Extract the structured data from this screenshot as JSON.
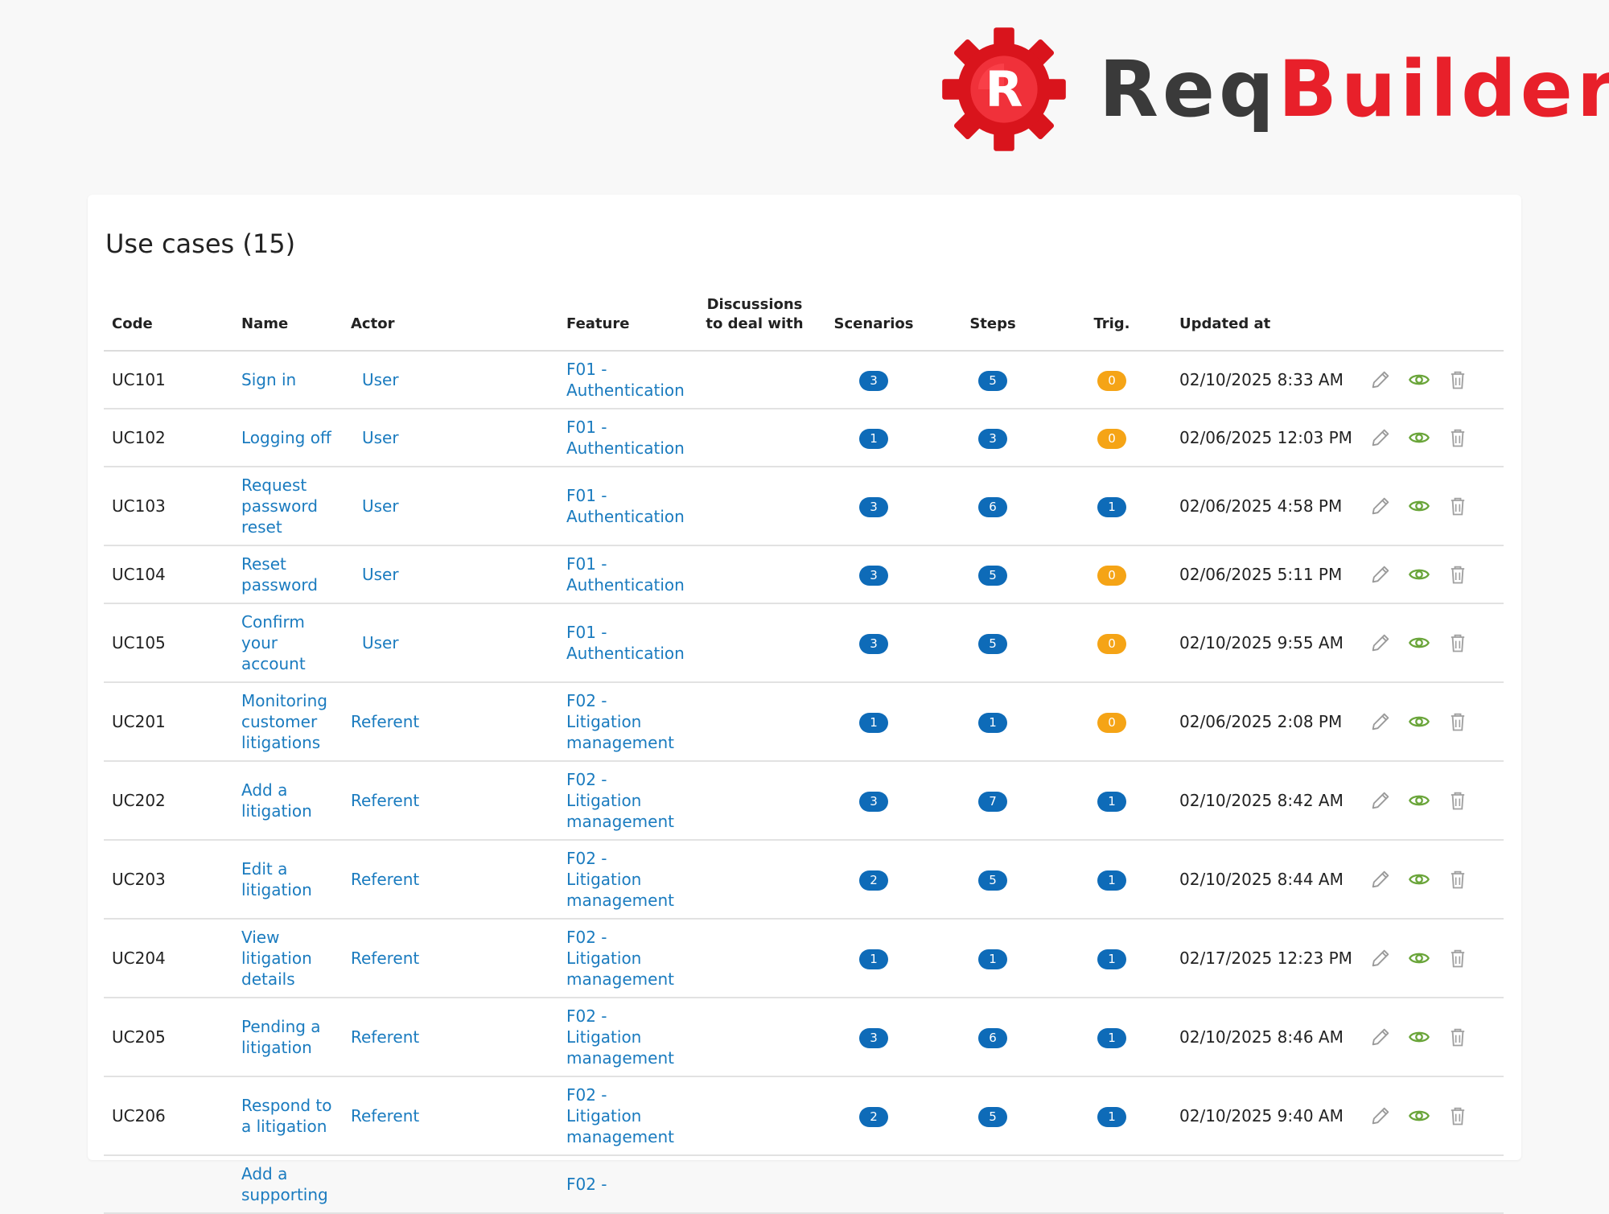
{
  "brand": {
    "req": "Req",
    "builder": "Builder",
    "logo_letter": "R"
  },
  "page": {
    "title": "Use cases (15)"
  },
  "table": {
    "headers": {
      "code": "Code",
      "name": "Name",
      "actor": "Actor",
      "feature": "Feature",
      "discussions": "Discussions to deal with",
      "scenarios": "Scenarios",
      "steps": "Steps",
      "trig": "Trig.",
      "updated": "Updated at"
    },
    "rows": [
      {
        "code": "UC101",
        "name": "Sign in",
        "actor": "User",
        "feature": "F01 - Authentication",
        "scenarios": "3",
        "steps": "5",
        "trig": "0",
        "updated": "02/10/2025 8:33 AM"
      },
      {
        "code": "UC102",
        "name": "Logging off",
        "actor": "User",
        "feature": "F01 - Authentication",
        "scenarios": "1",
        "steps": "3",
        "trig": "0",
        "updated": "02/06/2025 12:03 PM"
      },
      {
        "code": "UC103",
        "name": "Request password reset",
        "actor": "User",
        "feature": "F01 - Authentication",
        "scenarios": "3",
        "steps": "6",
        "trig": "1",
        "updated": "02/06/2025 4:58 PM"
      },
      {
        "code": "UC104",
        "name": "Reset password",
        "actor": "User",
        "feature": "F01 - Authentication",
        "scenarios": "3",
        "steps": "5",
        "trig": "0",
        "updated": "02/06/2025 5:11 PM"
      },
      {
        "code": "UC105",
        "name": "Confirm your account",
        "actor": "User",
        "feature": "F01 - Authentication",
        "scenarios": "3",
        "steps": "5",
        "trig": "0",
        "updated": "02/10/2025 9:55 AM"
      },
      {
        "code": "UC201",
        "name": "Monitoring customer litigations",
        "actor": "Referent",
        "feature": "F02 - Litigation management",
        "scenarios": "1",
        "steps": "1",
        "trig": "0",
        "updated": "02/06/2025 2:08 PM"
      },
      {
        "code": "UC202",
        "name": "Add a litigation",
        "actor": "Referent",
        "feature": "F02 - Litigation management",
        "scenarios": "3",
        "steps": "7",
        "trig": "1",
        "updated": "02/10/2025 8:42 AM"
      },
      {
        "code": "UC203",
        "name": "Edit a litigation",
        "actor": "Referent",
        "feature": "F02 - Litigation management",
        "scenarios": "2",
        "steps": "5",
        "trig": "1",
        "updated": "02/10/2025 8:44 AM"
      },
      {
        "code": "UC204",
        "name": "View litigation details",
        "actor": "Referent",
        "feature": "F02 - Litigation management",
        "scenarios": "1",
        "steps": "1",
        "trig": "1",
        "updated": "02/17/2025 12:23 PM"
      },
      {
        "code": "UC205",
        "name": "Pending a litigation",
        "actor": "Referent",
        "feature": "F02 - Litigation management",
        "scenarios": "3",
        "steps": "6",
        "trig": "1",
        "updated": "02/10/2025 8:46 AM"
      },
      {
        "code": "UC206",
        "name": "Respond to a litigation",
        "actor": "Referent",
        "feature": "F02 - Litigation management",
        "scenarios": "2",
        "steps": "5",
        "trig": "1",
        "updated": "02/10/2025 9:40 AM"
      },
      {
        "code": "",
        "name": "Add a supporting",
        "actor": "",
        "feature": "F02 -",
        "scenarios": "",
        "steps": "",
        "trig": "",
        "updated": ""
      }
    ]
  },
  "colors": {
    "link": "#1a7bbf",
    "pill_blue": "#0e6bb8",
    "pill_orange": "#f5a416",
    "brand_red": "#e8202a",
    "eye_green": "#6aa53a"
  },
  "icons": {
    "edit": "pencil-icon",
    "view": "eye-icon",
    "delete": "trash-icon"
  }
}
